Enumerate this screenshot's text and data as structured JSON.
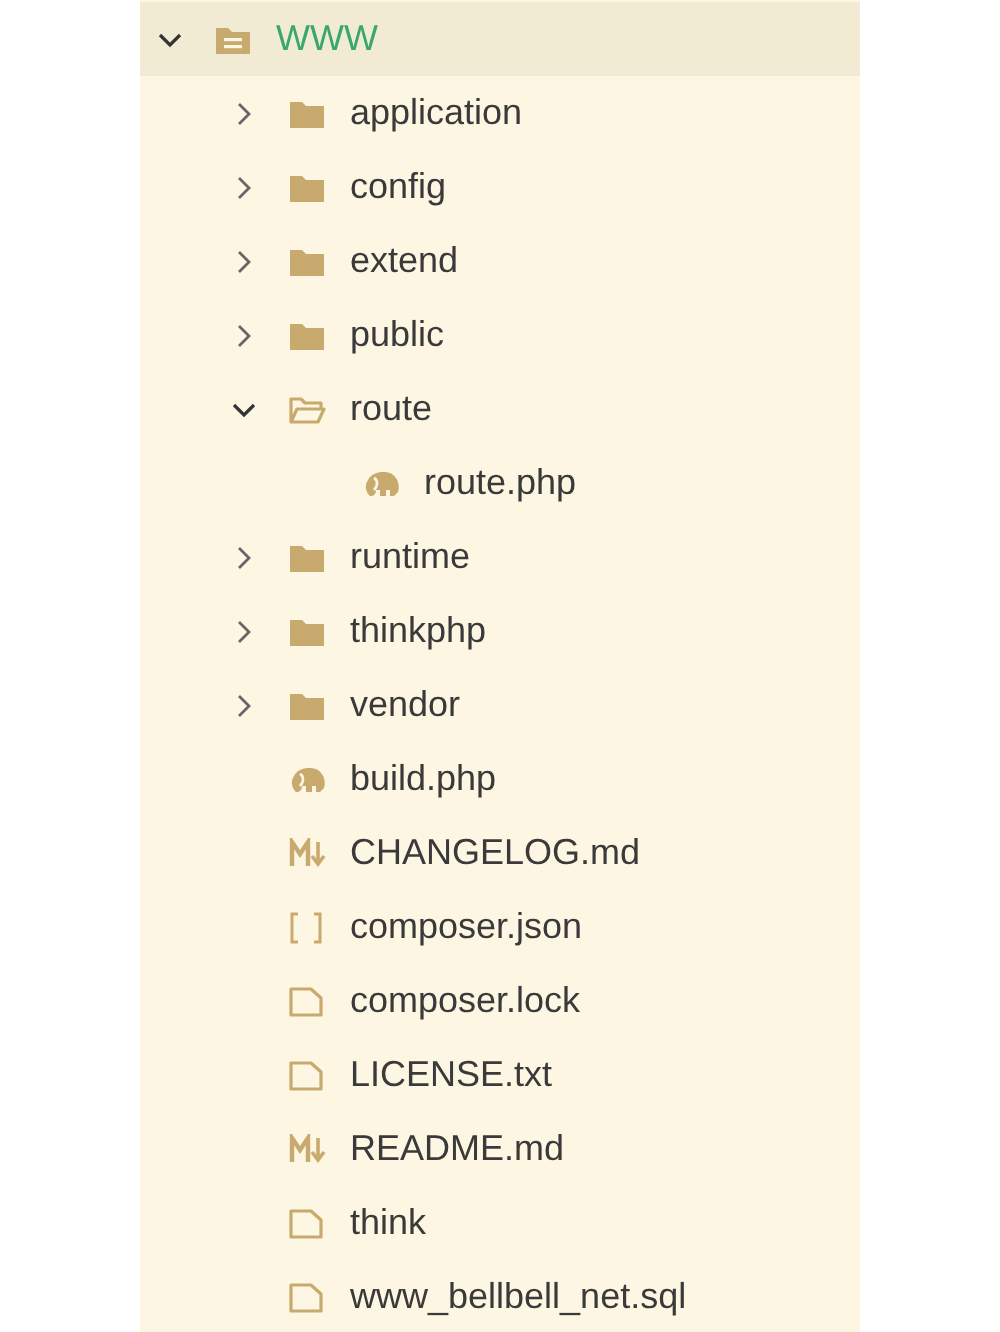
{
  "tree": [
    {
      "name": "WWW",
      "kind": "root",
      "expanded": true,
      "selected": true,
      "children": [
        {
          "name": "application",
          "kind": "folder",
          "expanded": false,
          "selected": false
        },
        {
          "name": "config",
          "kind": "folder",
          "expanded": false,
          "selected": false
        },
        {
          "name": "extend",
          "kind": "folder",
          "expanded": false,
          "selected": false
        },
        {
          "name": "public",
          "kind": "folder",
          "expanded": false,
          "selected": false
        },
        {
          "name": "route",
          "kind": "folder",
          "expanded": true,
          "selected": false,
          "children": [
            {
              "name": "route.php",
              "kind": "php",
              "selected": false
            }
          ]
        },
        {
          "name": "runtime",
          "kind": "folder",
          "expanded": false,
          "selected": false
        },
        {
          "name": "thinkphp",
          "kind": "folder",
          "expanded": false,
          "selected": false
        },
        {
          "name": "vendor",
          "kind": "folder",
          "expanded": false,
          "selected": false
        },
        {
          "name": "build.php",
          "kind": "php",
          "selected": false
        },
        {
          "name": "CHANGELOG.md",
          "kind": "markdown",
          "selected": false
        },
        {
          "name": "composer.json",
          "kind": "json",
          "selected": false
        },
        {
          "name": "composer.lock",
          "kind": "file",
          "selected": false
        },
        {
          "name": "LICENSE.txt",
          "kind": "file",
          "selected": false
        },
        {
          "name": "README.md",
          "kind": "markdown",
          "selected": false
        },
        {
          "name": "think",
          "kind": "file",
          "selected": false
        },
        {
          "name": "www_bellbell_net.sql",
          "kind": "file",
          "selected": false
        }
      ]
    }
  ]
}
